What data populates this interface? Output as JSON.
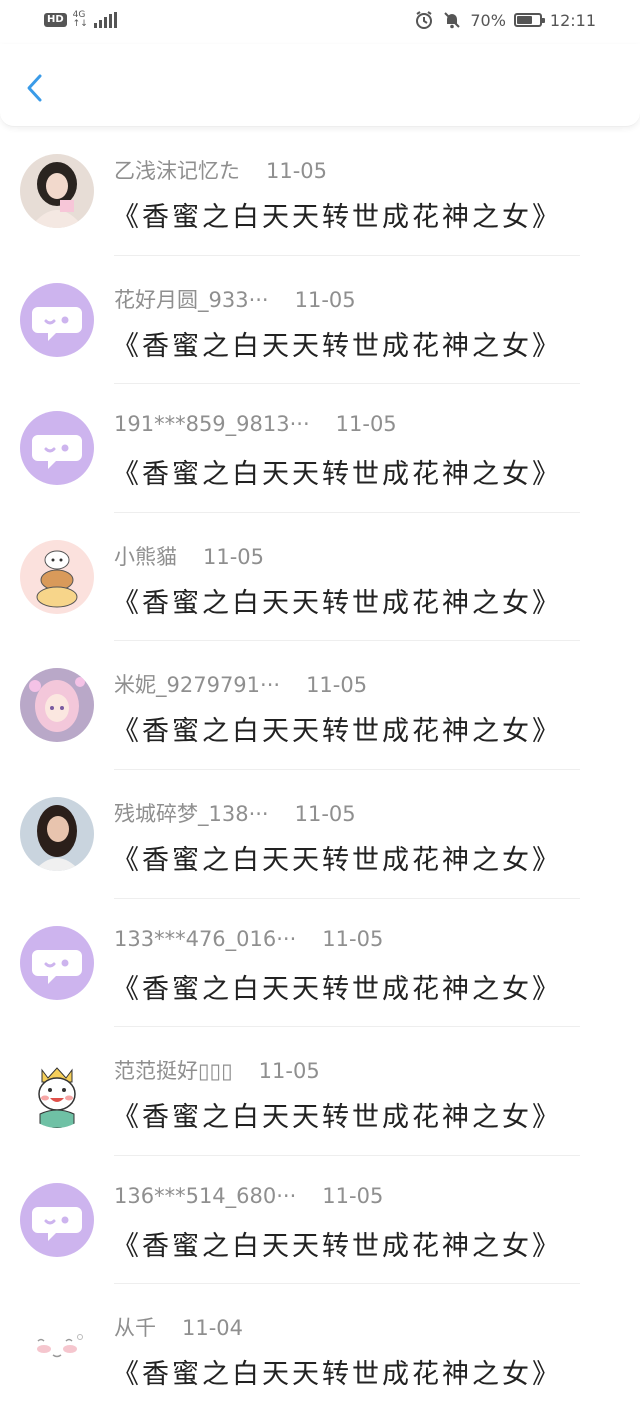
{
  "status_bar": {
    "hd": "HD",
    "network": "4G",
    "battery": "70%",
    "battery_fraction": 0.7,
    "time": "12:11"
  },
  "comments": [
    {
      "name": "乙浅沫记忆た",
      "date": "11-05",
      "message": "《香蜜之白天天转世成花神之女》",
      "avatar": "photo-girl-light"
    },
    {
      "name": "花好月圆_933···",
      "date": "11-05",
      "message": "《香蜜之白天天转世成花神之女》",
      "avatar": "default-chat-avatar"
    },
    {
      "name": "191***859_9813···",
      "date": "11-05",
      "message": "《香蜜之白天天转世成花神之女》",
      "avatar": "default-chat-avatar"
    },
    {
      "name": "小熊貓",
      "date": "11-05",
      "message": "《香蜜之白天天转世成花神之女》",
      "avatar": "cartoon-dog-stack"
    },
    {
      "name": "米妮_9279791···",
      "date": "11-05",
      "message": "《香蜜之白天天转世成花神之女》",
      "avatar": "anime-girl-pink"
    },
    {
      "name": "残城碎梦_138···",
      "date": "11-05",
      "message": "《香蜜之白天天转世成花神之女》",
      "avatar": "photo-woman-dark-hair"
    },
    {
      "name": "133***476_016···",
      "date": "11-05",
      "message": "《香蜜之白天天转世成花神之女》",
      "avatar": "default-chat-avatar"
    },
    {
      "name": "范范挺好▯▯▯",
      "date": "11-05",
      "message": "《香蜜之白天天转世成花神之女》",
      "avatar": "cartoon-boy-crown"
    },
    {
      "name": "136***514_680···",
      "date": "11-05",
      "message": "《香蜜之白天天转世成花神之女》",
      "avatar": "default-chat-avatar"
    },
    {
      "name": "从千",
      "date": "11-04",
      "message": "《香蜜之白天天转世成花神之女》",
      "avatar": "cartoon-blush-face"
    }
  ],
  "colors": {
    "default_avatar": "#cdb4ee",
    "back_arrow": "#3a9be8",
    "name_text": "#8f8f8f",
    "message_text": "#222222"
  }
}
